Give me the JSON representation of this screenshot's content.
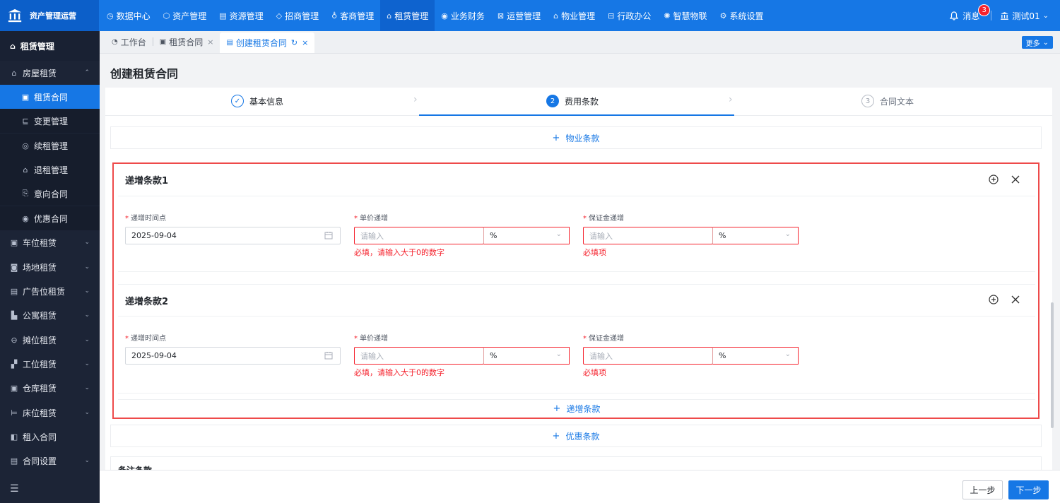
{
  "app": {
    "title": "资产管理运营"
  },
  "topnav": [
    {
      "label": "数据中心",
      "icon": "◷"
    },
    {
      "label": "资产管理",
      "icon": "⬡"
    },
    {
      "label": "资源管理",
      "icon": "▤"
    },
    {
      "label": "招商管理",
      "icon": "◇"
    },
    {
      "label": "客商管理",
      "icon": "♁"
    },
    {
      "label": "租赁管理",
      "icon": "⌂"
    },
    {
      "label": "业务财务",
      "icon": "◉"
    },
    {
      "label": "运营管理",
      "icon": "⊠"
    },
    {
      "label": "物业管理",
      "icon": "⌂"
    },
    {
      "label": "行政办公",
      "icon": "⊟"
    },
    {
      "label": "智慧物联",
      "icon": "✺"
    },
    {
      "label": "系统设置",
      "icon": "⚙"
    }
  ],
  "header": {
    "messages_label": "消息",
    "messages_count": "3",
    "user_name": "测试01"
  },
  "sidebar": {
    "section": "租赁管理",
    "items": [
      {
        "label": "房屋租赁",
        "icon": "⌂",
        "chev": "⌃"
      },
      {
        "label": "租赁合同",
        "icon": "▣"
      },
      {
        "label": "变更管理",
        "icon": "⊑"
      },
      {
        "label": "续租管理",
        "icon": "◎"
      },
      {
        "label": "退租管理",
        "icon": "⌂"
      },
      {
        "label": "意向合同",
        "icon": "⎘"
      },
      {
        "label": "优惠合同",
        "icon": "◉"
      },
      {
        "label": "车位租赁",
        "icon": "▣",
        "chev": "⌄"
      },
      {
        "label": "场地租赁",
        "icon": "◙",
        "chev": "⌄"
      },
      {
        "label": "广告位租赁",
        "icon": "▤",
        "chev": "⌄"
      },
      {
        "label": "公寓租赁",
        "icon": "▙",
        "chev": "⌄"
      },
      {
        "label": "摊位租赁",
        "icon": "⊖",
        "chev": "⌄"
      },
      {
        "label": "工位租赁",
        "icon": "▞",
        "chev": "⌄"
      },
      {
        "label": "仓库租赁",
        "icon": "▣",
        "chev": "⌄"
      },
      {
        "label": "床位租赁",
        "icon": "⊨",
        "chev": "⌄"
      },
      {
        "label": "租入合同",
        "icon": "◧"
      },
      {
        "label": "合同设置",
        "icon": "▤",
        "chev": "⌄"
      }
    ]
  },
  "tabs": [
    {
      "label": "工作台",
      "icon": "◔"
    },
    {
      "label": "租赁合同",
      "icon": "▣",
      "close": "×"
    },
    {
      "label": "创建租赁合同",
      "icon": "▤",
      "refresh": "↻",
      "close": "×"
    }
  ],
  "more_label": "更多",
  "page": {
    "title": "创建租赁合同"
  },
  "steps": [
    {
      "label": "基本信息",
      "mark": "✓"
    },
    {
      "label": "费用条款",
      "mark": "2"
    },
    {
      "label": "合同文本",
      "mark": "3"
    }
  ],
  "add_property": "物业条款",
  "clauses": [
    {
      "title": "递增条款1",
      "date_label": "递增时间点",
      "date_value": "2025-09-04",
      "price_label": "单价递增",
      "price_placeholder": "请输入",
      "price_unit": "%",
      "price_error": "必填，请输入大于0的数字",
      "deposit_label": "保证金递增",
      "deposit_placeholder": "请输入",
      "deposit_unit": "%",
      "deposit_error": "必填项"
    },
    {
      "title": "递增条款2",
      "date_label": "递增时间点",
      "date_value": "2025-09-04",
      "price_label": "单价递增",
      "price_placeholder": "请输入",
      "price_unit": "%",
      "price_error": "必填，请输入大于0的数字",
      "deposit_label": "保证金递增",
      "deposit_placeholder": "请输入",
      "deposit_unit": "%",
      "deposit_error": "必填项"
    }
  ],
  "required_mark": "*",
  "add_increment": "递增条款",
  "add_discount": "优惠条款",
  "remark_title": "备注条款",
  "footer": {
    "prev": "上一步",
    "next": "下一步"
  },
  "colors": {
    "primary": "#1677e5",
    "sidebar_bg": "#1c2436",
    "error": "#f5222d",
    "highlight": "#ee4a4a"
  }
}
